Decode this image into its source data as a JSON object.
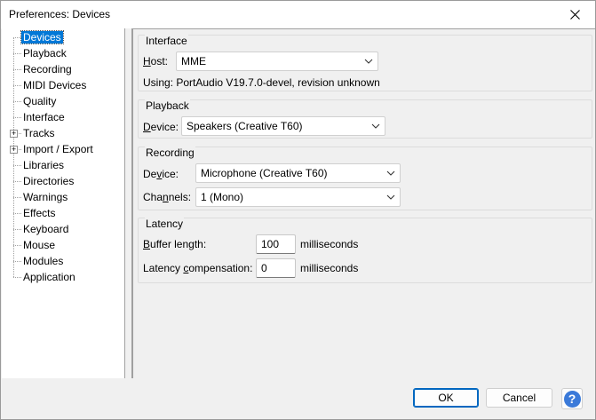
{
  "window": {
    "title": "Preferences: Devices"
  },
  "tree": {
    "items": [
      {
        "label": "Devices",
        "selected": true,
        "expandable": false
      },
      {
        "label": "Playback",
        "selected": false,
        "expandable": false
      },
      {
        "label": "Recording",
        "selected": false,
        "expandable": false
      },
      {
        "label": "MIDI Devices",
        "selected": false,
        "expandable": false
      },
      {
        "label": "Quality",
        "selected": false,
        "expandable": false
      },
      {
        "label": "Interface",
        "selected": false,
        "expandable": false
      },
      {
        "label": "Tracks",
        "selected": false,
        "expandable": true
      },
      {
        "label": "Import / Export",
        "selected": false,
        "expandable": true
      },
      {
        "label": "Libraries",
        "selected": false,
        "expandable": false
      },
      {
        "label": "Directories",
        "selected": false,
        "expandable": false
      },
      {
        "label": "Warnings",
        "selected": false,
        "expandable": false
      },
      {
        "label": "Effects",
        "selected": false,
        "expandable": false
      },
      {
        "label": "Keyboard",
        "selected": false,
        "expandable": false
      },
      {
        "label": "Mouse",
        "selected": false,
        "expandable": false
      },
      {
        "label": "Modules",
        "selected": false,
        "expandable": false
      },
      {
        "label": "Application",
        "selected": false,
        "expandable": false
      }
    ]
  },
  "interface": {
    "title": "Interface",
    "host_label_u": "H",
    "host_label_rest": "ost:",
    "host_value": "MME",
    "using_text": "Using: PortAudio V19.7.0-devel, revision unknown"
  },
  "playback": {
    "title": "Playback",
    "device_label_u": "D",
    "device_label_rest": "evice:",
    "device_value": "Speakers (Creative T60)"
  },
  "recording": {
    "title": "Recording",
    "device_label_pre": "De",
    "device_label_u": "v",
    "device_label_rest": "ice:",
    "device_value": "Microphone (Creative T60)",
    "channels_label_pre": "Cha",
    "channels_label_u": "n",
    "channels_label_rest": "nels:",
    "channels_value": "1 (Mono)"
  },
  "latency": {
    "title": "Latency",
    "buffer_label_u": "B",
    "buffer_label_rest": "uffer length:",
    "buffer_value": "100",
    "buffer_unit": "milliseconds",
    "comp_label_pre": "Latency ",
    "comp_label_u": "c",
    "comp_label_rest": "ompensation:",
    "comp_value": "0",
    "comp_unit": "milliseconds"
  },
  "buttons": {
    "ok": "OK",
    "cancel": "Cancel",
    "help": "?"
  },
  "icons": {
    "close": "close-icon",
    "chevron": "chevron-down-icon",
    "expander": "plus-expander-icon",
    "help": "help-icon"
  }
}
